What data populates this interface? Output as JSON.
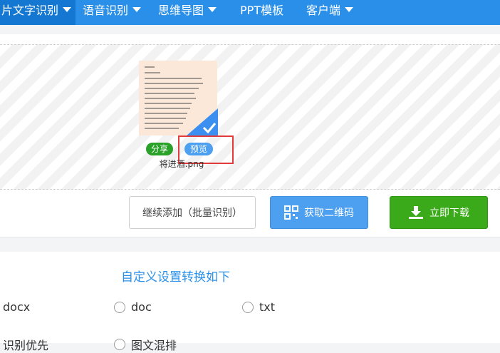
{
  "nav": {
    "items": [
      {
        "label": "片文字识别",
        "active": true
      },
      {
        "label": "语音识别",
        "active": false
      },
      {
        "label": "思维导图",
        "active": false
      },
      {
        "label": "PPT模板",
        "active": false
      },
      {
        "label": "客户端",
        "active": false
      }
    ]
  },
  "upload": {
    "file": {
      "name": "将进酒.png",
      "selected": true
    },
    "share_label": "分享",
    "preview_label": "预览"
  },
  "actions": {
    "continue_label": "继续添加（批量识别）",
    "qr_label": "获取二维码",
    "download_label": "立即下载"
  },
  "settings": {
    "title": "自定义设置转换如下",
    "formats": [
      "docx",
      "doc",
      "txt"
    ],
    "options": [
      "识别优先",
      "图文混排"
    ]
  },
  "colors": {
    "accent": "#2a8fe8",
    "download": "#3aaa1a",
    "highlight": "#e23b3b"
  }
}
